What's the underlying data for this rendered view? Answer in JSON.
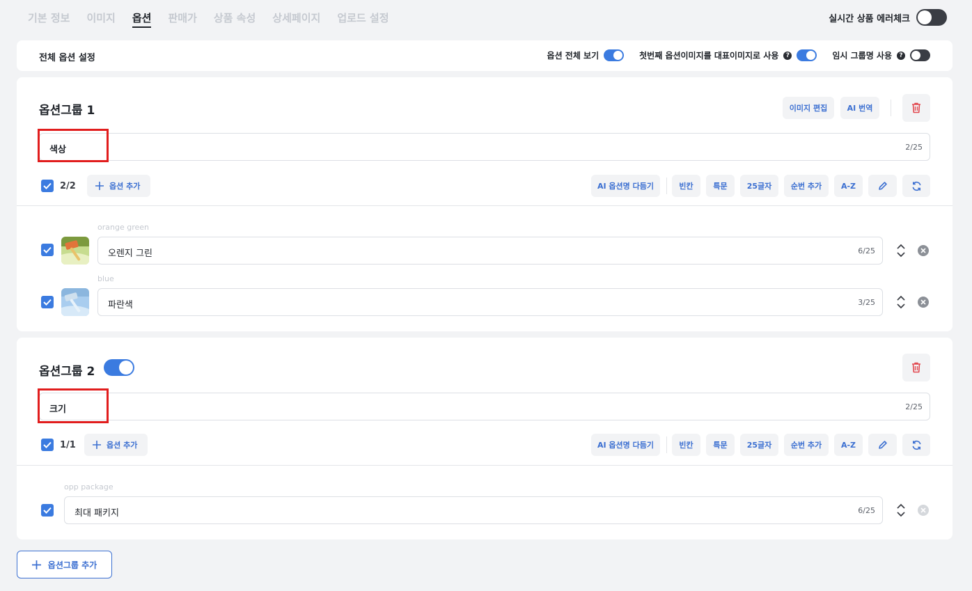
{
  "nav": {
    "tabs": [
      "기본 정보",
      "이미지",
      "옵션",
      "판매가",
      "상품 속성",
      "상세페이지",
      "업로드 설정"
    ],
    "active_tab": "옵션",
    "error_check_label": "실시간 상품 에러체크",
    "error_check_on": false
  },
  "global": {
    "title": "전체 옵션 설정",
    "view_all_label": "옵션 전체 보기",
    "view_all_on": true,
    "first_image_label": "첫번째 옵션이미지를 대표이미지로 사용",
    "first_image_on": true,
    "temp_group_label": "임시 그룹명 사용",
    "temp_group_on": false
  },
  "tool_buttons": [
    "AI 옵션명 다듬기",
    "빈칸",
    "특문",
    "25글자",
    "순번 추가",
    "A-Z"
  ],
  "add_option_label": "옵션 추가",
  "group1": {
    "title": "옵션그룹 1",
    "image_edit_label": "이미지 편집",
    "ai_translate_label": "AI 번역",
    "name": "색상",
    "name_count": "2/25",
    "selected_count": "2/2",
    "options": [
      {
        "source": "orange green",
        "name": "오렌지 그린",
        "count": "6/25"
      },
      {
        "source": "blue",
        "name": "파란색",
        "count": "3/25"
      }
    ]
  },
  "group2": {
    "title": "옵션그룹 2",
    "toggle_on": true,
    "name": "크기",
    "name_count": "2/25",
    "selected_count": "1/1",
    "options": [
      {
        "source": "opp package",
        "name": "최대 패키지",
        "count": "6/25"
      }
    ]
  },
  "add_group_label": "옵션그룹 추가",
  "colors": {
    "accent": "#3b7be0",
    "link": "#3b6fd1",
    "danger": "#e11d1d",
    "delete_icon": "#e2484f"
  }
}
